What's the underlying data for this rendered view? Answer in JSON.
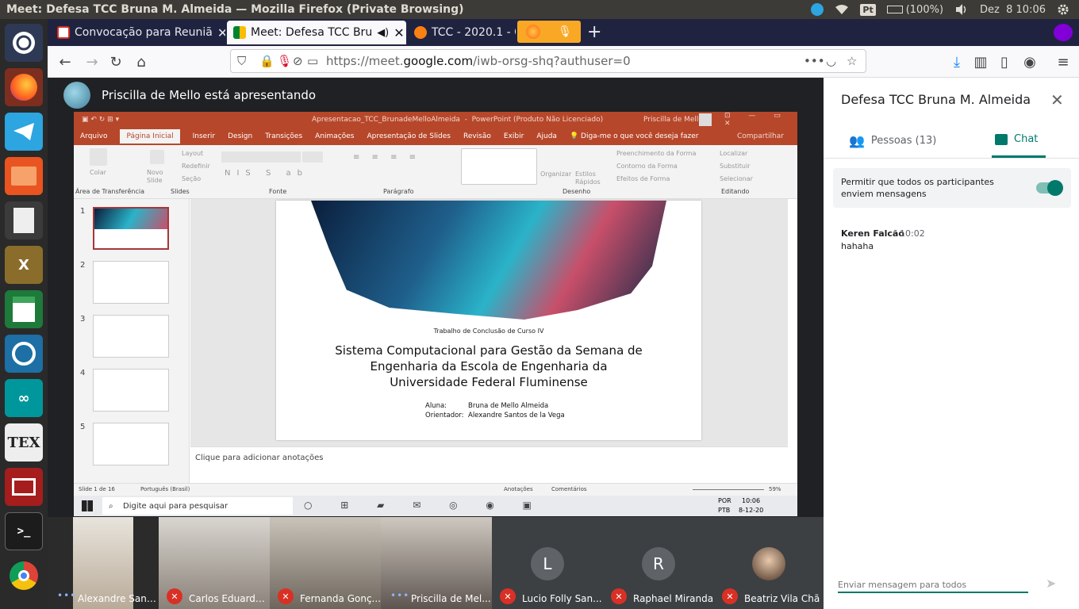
{
  "system": {
    "window_title": "Meet: Defesa TCC Bruna M. Almeida — Mozilla Firefox (Private Browsing)",
    "battery": "(100%)",
    "datetime": "Dez  8 10:06",
    "keyboard": "Pt"
  },
  "browser": {
    "tabs": [
      {
        "label": "Convocação para Reuniã"
      },
      {
        "label": "Meet: Defesa TCC Bru"
      },
      {
        "label": "TCC - 2020.1 - Or"
      }
    ],
    "url_prefix": "https://meet.",
    "url_domain": "google.com",
    "url_path": "/iwb-orsg-shq?authuser=0"
  },
  "meet": {
    "presenter_text": "Priscilla de Mello está apresentando",
    "participants": [
      {
        "name": "Alexandre Sant...",
        "muted": false
      },
      {
        "name": "Carlos Eduardo...",
        "muted": true
      },
      {
        "name": "Fernanda Gonç...",
        "muted": true
      },
      {
        "name": "Priscilla de Mel...",
        "muted": false
      },
      {
        "name": "Lucio Folly San...",
        "initial": "L",
        "muted": true
      },
      {
        "name": "Raphael Miranda",
        "initial": "R",
        "muted": true
      },
      {
        "name": "Beatriz Vila Chã",
        "muted": true
      }
    ]
  },
  "powerpoint": {
    "title": "Apresentacao_TCC_BrunadeMelloAlmeida  -  PowerPoint (Produto Não Licenciado)",
    "user": "Priscilla de Mello",
    "menu": [
      "Arquivo",
      "Página Inicial",
      "Inserir",
      "Design",
      "Transições",
      "Animações",
      "Apresentação de Slides",
      "Revisão",
      "Exibir",
      "Ajuda",
      "Diga-me o que você deseja fazer"
    ],
    "share": "Compartilhar",
    "groups": [
      "Área de Transferência",
      "Slides",
      "Fonte",
      "Parágrafo",
      "Desenho",
      "Editando"
    ],
    "ribbon_labels": {
      "paste": "Colar",
      "new_slide": "Novo Slide",
      "layout": "Layout",
      "reset": "Redefinir",
      "section": "Seção",
      "arrange": "Organizar",
      "quick_styles": "Estilos Rápidos",
      "fill": "Preenchimento da Forma",
      "outline": "Contorno da Forma",
      "effects": "Efeitos de Forma",
      "find": "Localizar",
      "replace": "Substituir",
      "select": "Selecionar"
    },
    "slide_numbers": [
      "1",
      "2",
      "3",
      "4",
      "5"
    ],
    "slide": {
      "subtitle": "Trabalho de Conclusão de Curso IV",
      "title_lines": [
        "Sistema Computacional para Gestão da Semana de",
        "Engenharia da Escola de Engenharia da",
        "Universidade Federal Fluminense"
      ],
      "student_label": "Aluna:",
      "student": "Bruna de Mello Almeida",
      "advisor_label": "Orientador:",
      "advisor": "Alexandre Santos de la Vega"
    },
    "notes_placeholder": "Clique para adicionar anotações",
    "status": {
      "slide": "Slide 1 de 16",
      "language": "Português (Brasil)",
      "notes": "Anotações",
      "comments": "Comentários",
      "zoom": "59%"
    }
  },
  "windows_taskbar": {
    "search_placeholder": "Digite aqui para pesquisar",
    "lang1": "POR",
    "lang2": "PTB",
    "time": "10:06",
    "date": "8-12-20"
  },
  "panel": {
    "title": "Defesa TCC Bruna M. Almeida",
    "tab_people": "Pessoas (13)",
    "tab_chat": "Chat",
    "permit_text": "Permitir que todos os participantes enviem mensagens",
    "message": {
      "sender": "Keren Falcão",
      "time": "10:02",
      "text": "hahaha"
    },
    "input_placeholder": "Enviar mensagem para todos"
  },
  "colors": {
    "accent": "#00796b",
    "ppt": "#b7472a",
    "muted": "#d93025"
  }
}
